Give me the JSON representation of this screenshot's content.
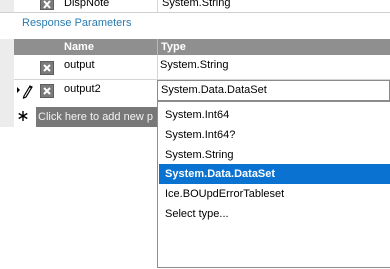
{
  "top_row": {
    "name": "DispNote",
    "type": "System.String"
  },
  "section_title": "Response Parameters",
  "grid": {
    "columns": [
      "Name",
      "Type"
    ],
    "rows": [
      {
        "name": "output",
        "type": "System.String"
      },
      {
        "name": "output2",
        "type": "System.Data.DataSet"
      }
    ],
    "new_row_placeholder": "Click here to add new p"
  },
  "type_dropdown": {
    "options": [
      "System.Int64",
      "System.Int64?",
      "System.String",
      "System.Data.DataSet",
      "Ice.BOUpdErrorTableset",
      "Select type..."
    ],
    "selected": "System.Data.DataSet"
  },
  "colors": {
    "header_bg": "#8f8f8f",
    "selection": "#0a72d0",
    "section_title": "#2a7ab0"
  },
  "icons": {
    "delete": "delete-x-icon",
    "edit_indicator": "pencil-edit-icon",
    "new_row": "asterisk-icon"
  }
}
